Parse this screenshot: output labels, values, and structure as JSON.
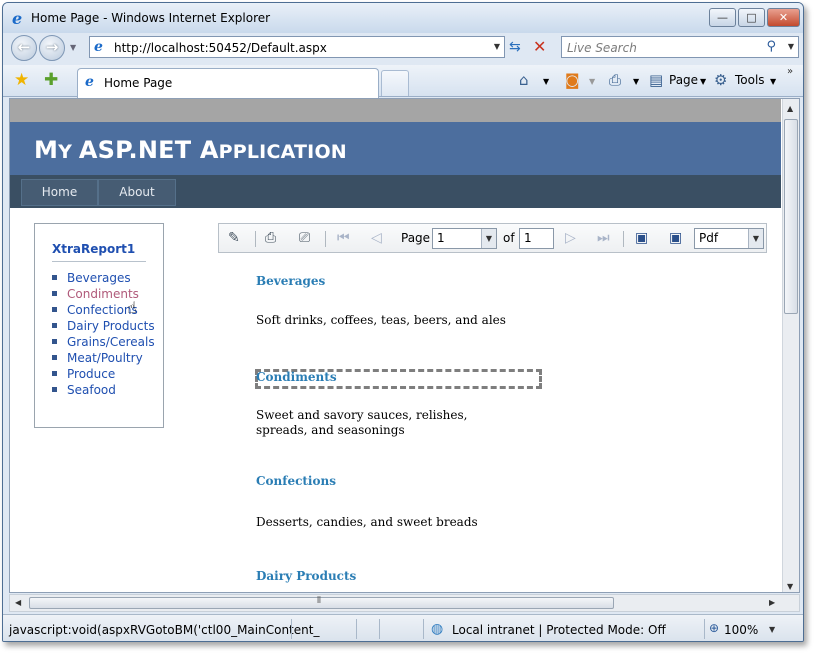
{
  "window": {
    "title": "Home Page - Windows Internet Explorer",
    "minimize_glyph": "—",
    "maximize_glyph": "□",
    "close_glyph": "✕"
  },
  "navbar": {
    "back_glyph": "←",
    "forward_glyph": "→",
    "address": "http://localhost:50452/Default.aspx",
    "search_placeholder": "Live Search"
  },
  "tabs": {
    "active_label": "Home Page"
  },
  "command_bar": {
    "page_label": "Page",
    "tools_label": "Tools",
    "overflow_glyph": "»"
  },
  "site": {
    "title_big_1": "M",
    "title_small_1": "Y ",
    "title_big_2": "ASP.NET A",
    "title_small_2": "PPLICATION",
    "menu": [
      "Home",
      "About"
    ]
  },
  "sidebar": {
    "title": "XtraReport1",
    "items": [
      "Beverages",
      "Condiments",
      "Confections",
      "Dairy Products",
      "Grains/Cereals",
      "Meat/Poultry",
      "Produce",
      "Seafood"
    ]
  },
  "report_toolbar": {
    "page_label": "Page",
    "page_value": "1",
    "of_label": "of",
    "total_pages": "1",
    "format_value": "Pdf"
  },
  "report": {
    "sections": [
      {
        "category": "Beverages",
        "description": "Soft drinks, coffees, teas, beers, and ales"
      },
      {
        "category": "Condiments",
        "description": "Sweet and savory sauces, relishes, spreads, and seasonings"
      },
      {
        "category": "Confections",
        "description": "Desserts, candies, and sweet breads"
      },
      {
        "category": "Dairy Products",
        "description": ""
      }
    ]
  },
  "statusbar": {
    "status_text": "javascript:void(aspxRVGotoBM('ctl00_MainContent_",
    "zone_text": "Local intranet | Protected Mode: Off",
    "zoom": "100%"
  }
}
